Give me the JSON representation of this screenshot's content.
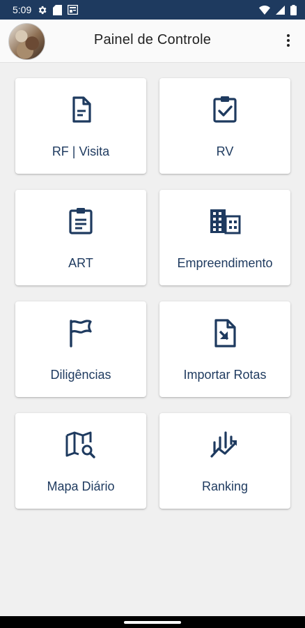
{
  "status_bar": {
    "time": "5:09",
    "left_icons": [
      "settings-icon",
      "sd-card-icon",
      "news-icon"
    ],
    "right_icons": [
      "wifi-icon",
      "cell-signal-icon",
      "battery-icon"
    ]
  },
  "app_bar": {
    "title": "Painel de Controle",
    "menu_icon": "more-vert-icon"
  },
  "tiles": [
    {
      "label": "RF | Visita",
      "icon": "document-icon"
    },
    {
      "label": "RV",
      "icon": "clipboard-check-icon"
    },
    {
      "label": "ART",
      "icon": "clipboard-list-icon"
    },
    {
      "label": "Empreendimento",
      "icon": "building-icon"
    },
    {
      "label": "Diligências",
      "icon": "flag-icon"
    },
    {
      "label": "Importar Rotas",
      "icon": "file-import-icon"
    },
    {
      "label": "Mapa Diário",
      "icon": "map-search-icon"
    },
    {
      "label": "Ranking",
      "icon": "trending-chart-icon"
    }
  ],
  "colors": {
    "status_bar": "#1e3a5f",
    "accent": "#1e3a5f",
    "background": "#f0f0f0",
    "tile": "#ffffff"
  }
}
